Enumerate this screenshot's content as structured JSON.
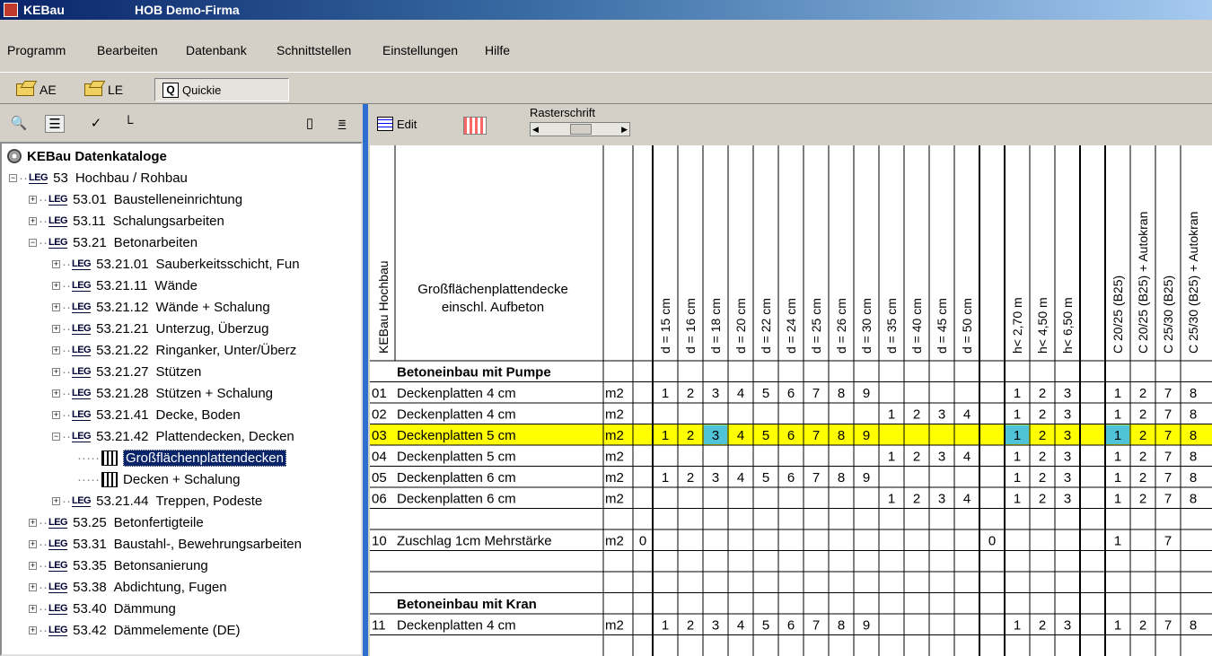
{
  "window": {
    "app_name": "KEBau",
    "title": "HOB Demo-Firma"
  },
  "menu": [
    "Programm",
    "Bearbeiten",
    "Datenbank",
    "Schnittstellen",
    "Einstellungen",
    "Hilfe"
  ],
  "toolbar": {
    "ae_label": "AE",
    "le_label": "LE",
    "quickie_label": "Quickie",
    "quickie_glyph": "Q"
  },
  "left_toolbar_icons": [
    "binoculars-icon",
    "numbered-list-icon",
    "spellcheck-icon",
    "tree-view-icon",
    "blank-page-icon",
    "sort-text-icon"
  ],
  "right_toolbar": {
    "edit_label": "Edit",
    "rasterschrift_label": "Rasterschrift"
  },
  "tree": {
    "root": "KEBau Datenkataloge",
    "leg_badge": "LEG",
    "nodes": [
      {
        "code": "53",
        "label": "Hochbau / Rohbau",
        "depth": 0,
        "expanded": true
      },
      {
        "code": "53.01",
        "label": "Baustelleneinrichtung",
        "depth": 1
      },
      {
        "code": "53.11",
        "label": "Schalungsarbeiten",
        "depth": 1
      },
      {
        "code": "53.21",
        "label": "Betonarbeiten",
        "depth": 1,
        "expanded": true
      },
      {
        "code": "53.21.01",
        "label": "Sauberkeitsschicht, Fun",
        "depth": 2
      },
      {
        "code": "53.21.11",
        "label": "Wände",
        "depth": 2
      },
      {
        "code": "53.21.12",
        "label": "Wände + Schalung",
        "depth": 2
      },
      {
        "code": "53.21.21",
        "label": "Unterzug, Überzug",
        "depth": 2
      },
      {
        "code": "53.21.22",
        "label": "Ringanker, Unter/Überz",
        "depth": 2
      },
      {
        "code": "53.21.27",
        "label": "Stützen",
        "depth": 2
      },
      {
        "code": "53.21.28",
        "label": "Stützen + Schalung",
        "depth": 2
      },
      {
        "code": "53.21.41",
        "label": "Decke, Boden",
        "depth": 2
      },
      {
        "code": "53.21.42",
        "label": "Plattendecken, Decken",
        "depth": 2,
        "expanded": true
      },
      {
        "code": "",
        "label": "Großflächenplattendecken",
        "depth": 3,
        "leaf": true,
        "selected": true
      },
      {
        "code": "",
        "label": "Decken + Schalung",
        "depth": 3,
        "leaf": true
      },
      {
        "code": "53.21.44",
        "label": "Treppen, Podeste",
        "depth": 2
      },
      {
        "code": "53.25",
        "label": "Betonfertigteile",
        "depth": 1
      },
      {
        "code": "53.31",
        "label": "Baustahl-, Bewehrungsarbeiten",
        "depth": 1
      },
      {
        "code": "53.35",
        "label": "Betonsanierung",
        "depth": 1
      },
      {
        "code": "53.38",
        "label": "Abdichtung, Fugen",
        "depth": 1
      },
      {
        "code": "53.40",
        "label": "Dämmung",
        "depth": 1
      },
      {
        "code": "53.42",
        "label": "Dämmelemente (DE)",
        "depth": 1
      }
    ]
  },
  "table": {
    "catalog_label": "KEBau Hochbau",
    "title_line1": "Großflächenplattendecke",
    "title_line2": "einschl. Aufbeton",
    "column_headers": [
      "",
      "d = 15 cm",
      "d = 16 cm",
      "d = 18 cm",
      "d = 20 cm",
      "d = 22 cm",
      "d = 24 cm",
      "d = 25 cm",
      "d = 26 cm",
      "d = 30 cm",
      "d = 35 cm",
      "d = 40 cm",
      "d = 45 cm",
      "d = 50 cm",
      "",
      "h< 2,70 m",
      "h< 4,50 m",
      "h< 6,50 m",
      "",
      "C 20/25 (B25)",
      "C 20/25 (B25) + Autokran",
      "C 25/30 (B25)",
      "C 25/30 (B25) + Autokran"
    ],
    "sections": [
      {
        "heading": "Betoneinbau mit Pumpe",
        "rows": [
          {
            "nr": "01",
            "text": "Deckenplatten 4 cm",
            "unit": "m2",
            "cells": [
              "",
              "1",
              "2",
              "3",
              "4",
              "5",
              "6",
              "7",
              "8",
              "9",
              "",
              "",
              "",
              "",
              "",
              "1",
              "2",
              "3",
              "",
              "1",
              "2",
              "7",
              "8"
            ]
          },
          {
            "nr": "02",
            "text": "Deckenplatten 4 cm",
            "unit": "m2",
            "cells": [
              "",
              "",
              "",
              "",
              "",
              "",
              "",
              "",
              "",
              "",
              "1",
              "2",
              "3",
              "4",
              "",
              "1",
              "2",
              "3",
              "",
              "1",
              "2",
              "7",
              "8"
            ]
          },
          {
            "nr": "03",
            "text": "Deckenplatten 5 cm",
            "unit": "m2",
            "selected": true,
            "cells": [
              "",
              "1",
              "2",
              "3",
              "4",
              "5",
              "6",
              "7",
              "8",
              "9",
              "",
              "",
              "",
              "",
              "",
              "1",
              "2",
              "3",
              "",
              "1",
              "2",
              "7",
              "8"
            ]
          },
          {
            "nr": "04",
            "text": "Deckenplatten 5 cm",
            "unit": "m2",
            "cells": [
              "",
              "",
              "",
              "",
              "",
              "",
              "",
              "",
              "",
              "",
              "1",
              "2",
              "3",
              "4",
              "",
              "1",
              "2",
              "3",
              "",
              "1",
              "2",
              "7",
              "8"
            ]
          },
          {
            "nr": "05",
            "text": "Deckenplatten 6 cm",
            "unit": "m2",
            "cells": [
              "",
              "1",
              "2",
              "3",
              "4",
              "5",
              "6",
              "7",
              "8",
              "9",
              "",
              "",
              "",
              "",
              "",
              "1",
              "2",
              "3",
              "",
              "1",
              "2",
              "7",
              "8"
            ]
          },
          {
            "nr": "06",
            "text": "Deckenplatten 6 cm",
            "unit": "m2",
            "cells": [
              "",
              "",
              "",
              "",
              "",
              "",
              "",
              "",
              "",
              "",
              "1",
              "2",
              "3",
              "4",
              "",
              "1",
              "2",
              "3",
              "",
              "1",
              "2",
              "7",
              "8"
            ]
          },
          {
            "blank": true
          },
          {
            "nr": "10",
            "text": "Zuschlag 1cm Mehrstärke",
            "unit": "m2",
            "cells": [
              "0",
              "",
              "",
              "",
              "",
              "",
              "",
              "",
              "",
              "",
              "",
              "",
              "",
              "",
              "0",
              "",
              "",
              "",
              "",
              "1",
              "",
              "7",
              ""
            ]
          },
          {
            "blank": true
          },
          {
            "blank": true
          }
        ]
      },
      {
        "heading": "Betoneinbau mit Kran",
        "rows": [
          {
            "nr": "11",
            "text": "Deckenplatten 4 cm",
            "unit": "m2",
            "cells": [
              "",
              "1",
              "2",
              "3",
              "4",
              "5",
              "6",
              "7",
              "8",
              "9",
              "",
              "",
              "",
              "",
              "",
              "1",
              "2",
              "3",
              "",
              "1",
              "2",
              "7",
              "8"
            ]
          }
        ]
      }
    ],
    "colors": {
      "selected_row": "#ffff00",
      "highlight_cell": "#4fc3d8"
    }
  }
}
